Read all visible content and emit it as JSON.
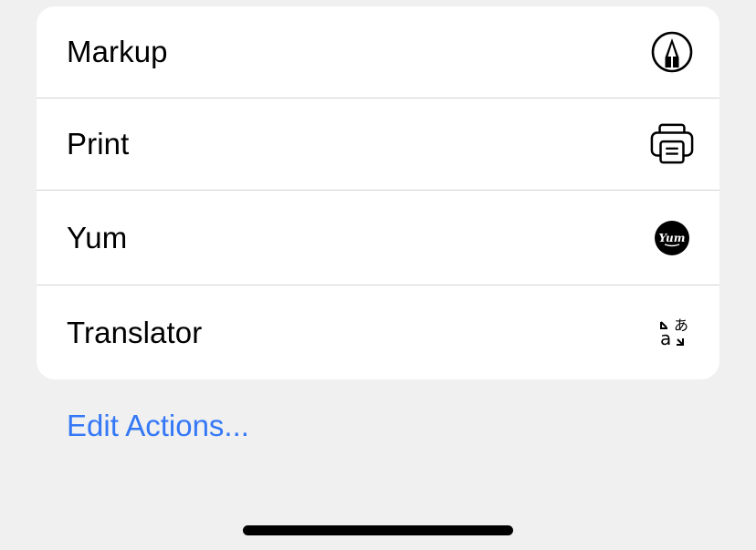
{
  "actions": [
    {
      "label": "Markup",
      "icon": "markup-icon"
    },
    {
      "label": "Print",
      "icon": "printer-icon"
    },
    {
      "label": "Yum",
      "icon": "yum-app-icon",
      "icon_text": "Yum"
    },
    {
      "label": "Translator",
      "icon": "translate-icon",
      "icon_text_latin": "a",
      "icon_text_kana": "あ"
    }
  ],
  "edit_actions_label": "Edit Actions...",
  "colors": {
    "background": "#f0f0f1",
    "card": "#ffffff",
    "link": "#3478f6",
    "divider": "#d2d2d6"
  }
}
